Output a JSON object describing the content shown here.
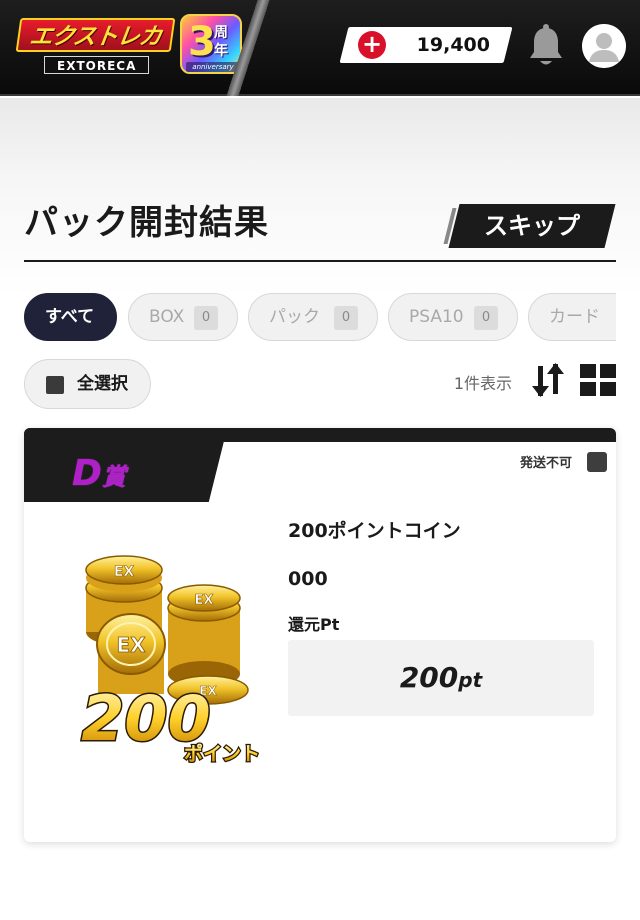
{
  "header": {
    "logo_text": "エクストレカ",
    "logo_sub": "EXTORECA",
    "anniversary_number": "3",
    "anniversary_kanji": "周年",
    "anniversary_word": "anniversary",
    "points_balance": "19,400",
    "add_points_symbol": "+"
  },
  "page": {
    "title": "パック開封結果",
    "skip_label": "スキップ"
  },
  "filters": [
    {
      "label": "すべて",
      "count": null,
      "active": true
    },
    {
      "label": "BOX",
      "count": "0",
      "active": false
    },
    {
      "label": "パック",
      "count": "0",
      "active": false
    },
    {
      "label": "PSA10",
      "count": "0",
      "active": false
    },
    {
      "label": "カード",
      "count": "",
      "active": false
    }
  ],
  "toolbar": {
    "select_all_label": "全選択",
    "result_count": "1件表示",
    "sort_icon": "sort-icon",
    "grid_icon": "grid-view-icon"
  },
  "card": {
    "prize_letter": "D",
    "prize_kanji": "賞",
    "ship_label": "発送不可",
    "item_name": "200ポイントコイン",
    "item_code": "000",
    "refund_label": "還元Pt",
    "refund_amount": "200",
    "refund_unit": "pt",
    "art_coin_text": "EX",
    "art_amount": "200",
    "art_caption": "ポイント"
  },
  "colors": {
    "header_bg": "#111111",
    "accent_red": "#d9102a",
    "chip_active": "#1f2238",
    "prize_purple": "#b020c8"
  }
}
